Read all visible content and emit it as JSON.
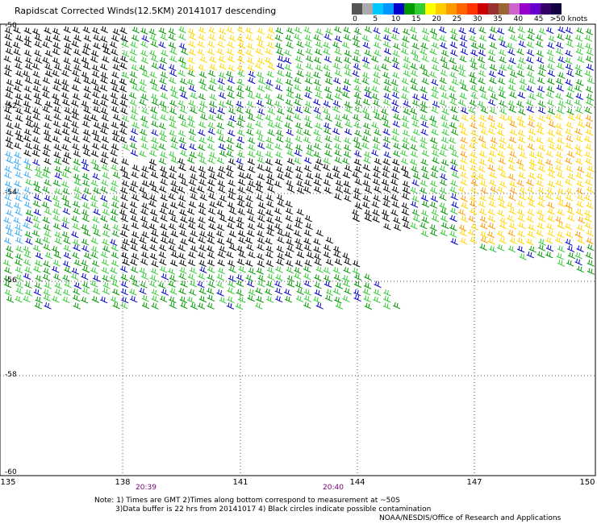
{
  "title": "Rapidscat Corrected Winds(12.5KM) 20141017 descending",
  "colorbar": {
    "labels": [
      "0",
      "5",
      "10",
      "15",
      "20",
      "25",
      "30",
      "35",
      "40",
      "45",
      ">50 knots"
    ],
    "colors": [
      "#555555",
      "#aaaaaa",
      "#00c8ff",
      "#0096ff",
      "#0000cc",
      "#009900",
      "#33cc33",
      "#ffff00",
      "#ffcc00",
      "#ff9900",
      "#ff6600",
      "#ff3300",
      "#cc0000",
      "#993333",
      "#996633",
      "#cc66cc",
      "#9900cc",
      "#6600cc",
      "#330066",
      "#110044"
    ]
  },
  "map": {
    "lat_labels": [
      "-50",
      "-52",
      "-54",
      "-56",
      "-58",
      "-60"
    ],
    "lon_labels": [
      "135",
      "138",
      "141",
      "144",
      "147",
      "150"
    ],
    "time_labels": [
      "20:39",
      "20:40"
    ]
  },
  "notes": {
    "line1": "Note: 1) Times are GMT 2)Times along bottom correspond to measurement at ~50S",
    "line2": "3)Data buffer is 22 hrs from 20141017 4) Black circles indicate possible contamination",
    "line3": "NOAA/NESDIS/Office of Research and Applications"
  }
}
